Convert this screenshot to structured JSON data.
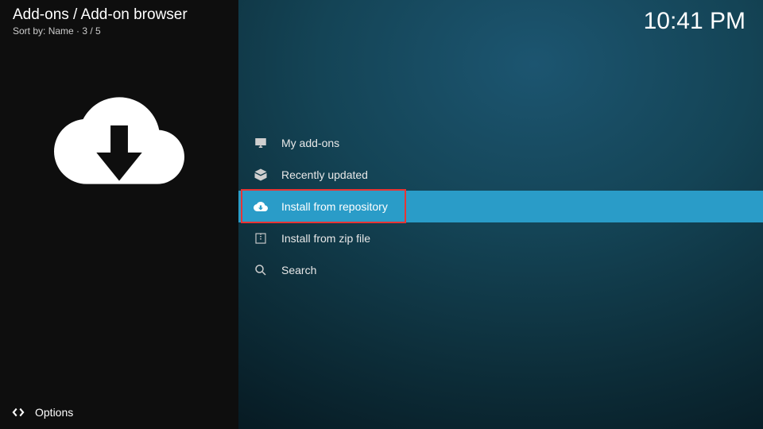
{
  "header": {
    "title": "Add-ons / Add-on browser",
    "sort_prefix": "Sort by: ",
    "sort_name": "Name",
    "sort_sep": "  ·  ",
    "sort_count": "3 / 5"
  },
  "clock": "10:41 PM",
  "footer": {
    "options_label": "Options"
  },
  "menu": {
    "items": [
      {
        "label": "My add-ons",
        "icon": "monitor-icon",
        "selected": false
      },
      {
        "label": "Recently updated",
        "icon": "box-open-icon",
        "selected": false
      },
      {
        "label": "Install from repository",
        "icon": "cloud-download-icon",
        "selected": true,
        "highlight": true
      },
      {
        "label": "Install from zip file",
        "icon": "zip-icon",
        "selected": false
      },
      {
        "label": "Search",
        "icon": "search-icon",
        "selected": false
      }
    ]
  }
}
